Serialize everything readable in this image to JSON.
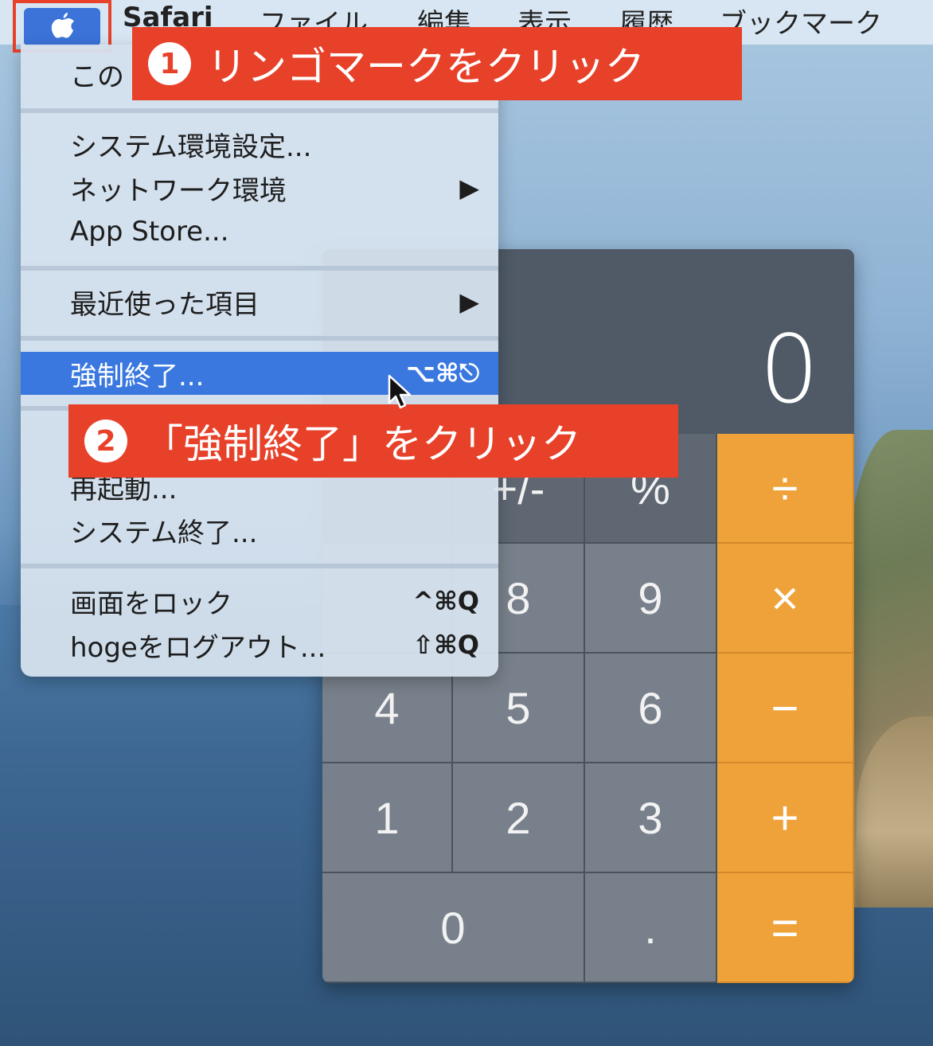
{
  "menubar": {
    "app_name": "Safari",
    "items": [
      "ファイル",
      "編集",
      "表示",
      "履歴",
      "ブックマーク"
    ]
  },
  "apple_menu": {
    "items": [
      {
        "label": "この",
        "shortcut": ""
      },
      {
        "label": "システム環境設定...",
        "shortcut": ""
      },
      {
        "label": "ネットワーク環境",
        "shortcut": "▶"
      },
      {
        "label": "App Store...",
        "shortcut": ""
      },
      {
        "label": "最近使った項目",
        "shortcut": "▶"
      },
      {
        "label": "強制終了...",
        "shortcut": "⌥⌘⎋"
      },
      {
        "label": "再起動...",
        "shortcut": ""
      },
      {
        "label": "システム終了...",
        "shortcut": ""
      },
      {
        "label": "画面をロック",
        "shortcut": "^⌘Q"
      },
      {
        "label": "hogeをログアウト...",
        "shortcut": "⇧⌘Q"
      }
    ]
  },
  "callouts": {
    "step1_num": "1",
    "step1_text": "リンゴマークをクリック",
    "step2_num": "2",
    "step2_text": "「強制終了」をクリック"
  },
  "calculator": {
    "display": "0",
    "keys": {
      "plusminus": "+/-",
      "percent": "%",
      "divide": "÷",
      "k8": "8",
      "k9": "9",
      "multiply": "×",
      "k4": "4",
      "k5": "5",
      "k6": "6",
      "minus": "−",
      "k1": "1",
      "k2": "2",
      "k3": "3",
      "plus": "+",
      "k0": "0",
      "dot": ".",
      "equals": "="
    }
  },
  "colors": {
    "callout": "#e8412a",
    "selection": "#3a78e0",
    "operator": "#f0a23a"
  }
}
